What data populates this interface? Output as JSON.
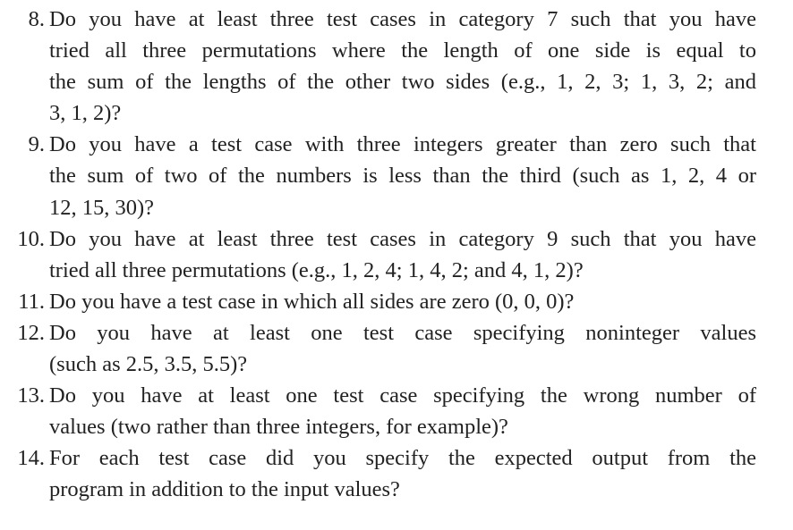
{
  "items": [
    {
      "number": "8.",
      "lines": [
        "Do you have at least three test cases in category 7 such that you have",
        "tried all three permutations where the length of one side is equal to",
        "the sum of the lengths of the other two sides (e.g., 1, 2, 3; 1, 3, 2; and",
        "3, 1, 2)?"
      ]
    },
    {
      "number": "9.",
      "lines": [
        "Do you have a test case with three integers greater than zero such that",
        "the sum of two of the numbers is less than the third (such as 1, 2, 4 or",
        "12, 15, 30)?"
      ]
    },
    {
      "number": "10.",
      "lines": [
        "Do you have at least three test cases in category 9 such that you have",
        "tried all three permutations (e.g., 1, 2, 4; 1, 4, 2; and 4, 1, 2)?"
      ]
    },
    {
      "number": "11.",
      "lines": [
        "Do you have a test case in which all sides are zero (0, 0, 0)?"
      ]
    },
    {
      "number": "12.",
      "lines": [
        "Do you have at least one test case specifying noninteger values",
        "(such as 2.5, 3.5, 5.5)?"
      ]
    },
    {
      "number": "13.",
      "lines": [
        "Do you have at least one test case specifying the wrong number of",
        "values (two rather than three integers, for example)?"
      ]
    },
    {
      "number": "14.",
      "lines": [
        "For each test case did you specify the expected output from the",
        "program in addition to the input values?"
      ]
    }
  ]
}
